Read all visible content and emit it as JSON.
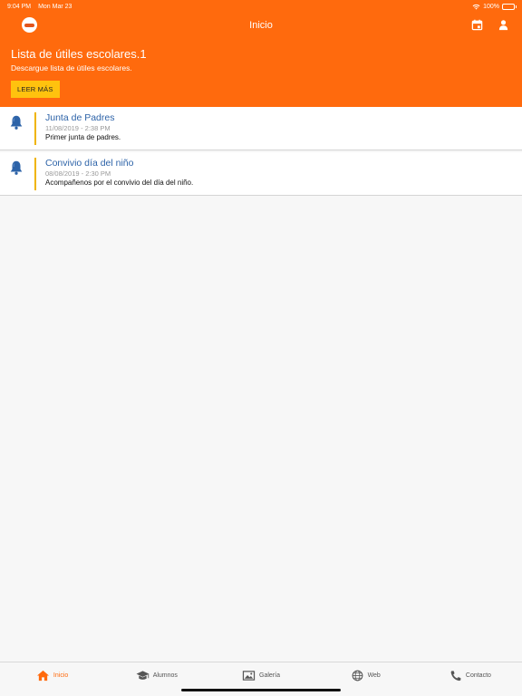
{
  "status_bar": {
    "time": "9:04 PM",
    "date": "Mon Mar 23",
    "battery": "100%"
  },
  "nav": {
    "title": "Inicio"
  },
  "banner": {
    "title": "Lista de útiles escolares.1",
    "subtitle": "Descargue lista de útiles escolares.",
    "button_label": "LEER MÁS"
  },
  "items": [
    {
      "title": "Junta de Padres",
      "date": "11/08/2019 - 2:38 PM",
      "description": "Primer junta de padres."
    },
    {
      "title": "Convivio día del niño",
      "date": "08/08/2019 - 2:30 PM",
      "description": "Acompañenos por el convivio del día del niño."
    }
  ],
  "tabs": [
    {
      "label": "Inicio",
      "icon": "home-icon",
      "active": true
    },
    {
      "label": "Alumnos",
      "icon": "graduation-cap-icon",
      "active": false
    },
    {
      "label": "Galería",
      "icon": "image-icon",
      "active": false
    },
    {
      "label": "Web",
      "icon": "globe-icon",
      "active": false
    },
    {
      "label": "Contacto",
      "icon": "phone-icon",
      "active": false
    }
  ],
  "colors": {
    "primary": "#ff6a0d",
    "accent": "#ffc20e",
    "link": "#2d63a8",
    "bell": "#2d63a8"
  }
}
